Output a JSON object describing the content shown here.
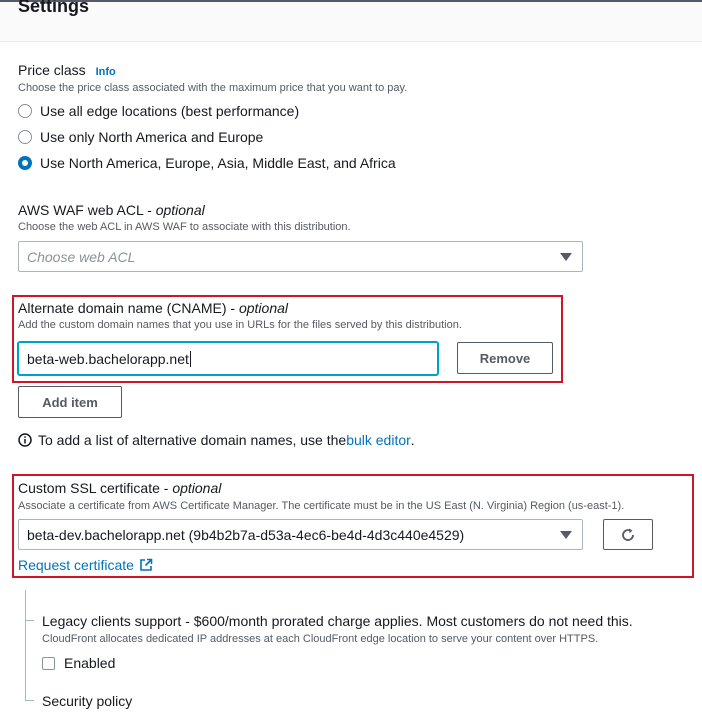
{
  "section": {
    "title": "Settings"
  },
  "price_class": {
    "label": "Price class",
    "info": "Info",
    "description": "Choose the price class associated with the maximum price that you want to pay.",
    "options": [
      "Use all edge locations (best performance)",
      "Use only North America and Europe",
      "Use North America, Europe, Asia, Middle East, and Africa"
    ],
    "selected_index": 2
  },
  "waf": {
    "label": "AWS WAF web ACL - ",
    "optional": "optional",
    "description": "Choose the web ACL in AWS WAF to associate with this distribution.",
    "placeholder": "Choose web ACL"
  },
  "cname": {
    "label": "Alternate domain name (CNAME) - ",
    "optional": "optional",
    "description": "Add the custom domain names that you use in URLs for the files served by this distribution.",
    "value": "beta-web.bachelorapp.net",
    "remove_label": "Remove",
    "add_item_label": "Add item",
    "note_prefix": "To add a list of alternative domain names, use the ",
    "note_link": "bulk editor",
    "note_suffix": "."
  },
  "ssl": {
    "label": "Custom SSL certificate - ",
    "optional": "optional",
    "description": "Associate a certificate from AWS Certificate Manager. The certificate must be in the US East (N. Virginia) Region (us-east-1).",
    "value": "beta-dev.bachelorapp.net (9b4b2b7a-d53a-4ec6-be4d-4d3c440e4529)",
    "request_link": "Request certificate"
  },
  "legacy": {
    "label": "Legacy clients support - $600/month prorated charge applies. Most customers do not need this.",
    "description": "CloudFront allocates dedicated IP addresses at each CloudFront edge location to serve your content over HTTPS.",
    "checkbox_label": "Enabled",
    "checked": false
  },
  "security_policy": {
    "label": "Security policy"
  },
  "colors": {
    "accent": "#0073bb",
    "highlight": "#d0152b",
    "focus": "#00a1c9"
  }
}
